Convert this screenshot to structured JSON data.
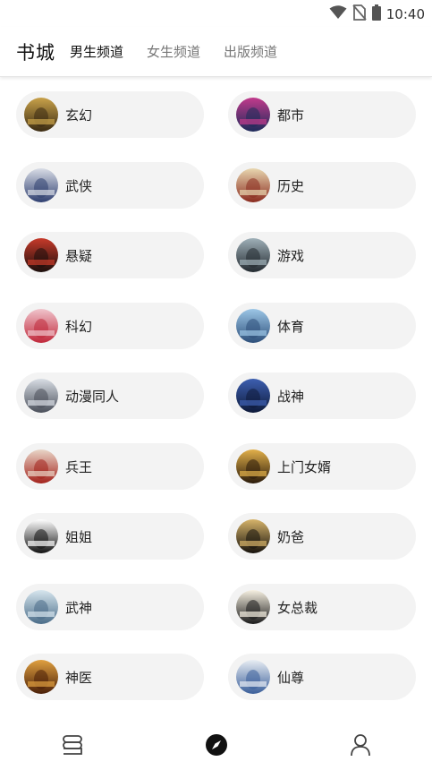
{
  "status_bar": {
    "time": "10:40",
    "icons": [
      "wifi-icon",
      "no-sim-icon",
      "battery-icon"
    ]
  },
  "header": {
    "brand": "书城",
    "tabs": [
      {
        "label": "男生频道",
        "active": true
      },
      {
        "label": "女生频道",
        "active": false
      },
      {
        "label": "出版频道",
        "active": false
      }
    ]
  },
  "categories": [
    {
      "label": "玄幻",
      "cover_colors": [
        "#c9a24a",
        "#3a2a12"
      ]
    },
    {
      "label": "都市",
      "cover_colors": [
        "#c23a8c",
        "#1d2b5a"
      ]
    },
    {
      "label": "武侠",
      "cover_colors": [
        "#d9dde6",
        "#2f3f70"
      ]
    },
    {
      "label": "历史",
      "cover_colors": [
        "#e8d7b0",
        "#8a2b1f"
      ]
    },
    {
      "label": "悬疑",
      "cover_colors": [
        "#c73a2a",
        "#1a0e0c"
      ]
    },
    {
      "label": "游戏",
      "cover_colors": [
        "#9fb0b8",
        "#232a30"
      ]
    },
    {
      "label": "科幻",
      "cover_colors": [
        "#f0c4cc",
        "#c0283a"
      ]
    },
    {
      "label": "体育",
      "cover_colors": [
        "#9cc6e6",
        "#2d4f7a"
      ]
    },
    {
      "label": "动漫同人",
      "cover_colors": [
        "#d8dde4",
        "#4a4f5a"
      ]
    },
    {
      "label": "战神",
      "cover_colors": [
        "#3d5fb0",
        "#0e1a3a"
      ]
    },
    {
      "label": "兵王",
      "cover_colors": [
        "#e9d6c8",
        "#a3221c"
      ]
    },
    {
      "label": "上门女婿",
      "cover_colors": [
        "#e2b04a",
        "#2a1a0a"
      ]
    },
    {
      "label": "姐姐",
      "cover_colors": [
        "#ffffff",
        "#111111"
      ]
    },
    {
      "label": "奶爸",
      "cover_colors": [
        "#d7b46a",
        "#16120c"
      ]
    },
    {
      "label": "武神",
      "cover_colors": [
        "#d7e6ee",
        "#4a6c88"
      ]
    },
    {
      "label": "女总裁",
      "cover_colors": [
        "#f7f1e2",
        "#1a1a1a"
      ]
    },
    {
      "label": "神医",
      "cover_colors": [
        "#e0a040",
        "#4a1f08"
      ]
    },
    {
      "label": "仙尊",
      "cover_colors": [
        "#e8edf3",
        "#3b5f9a"
      ]
    }
  ],
  "bottom_nav": [
    {
      "name": "bookshelf",
      "icon": "bookshelf-icon",
      "active": false
    },
    {
      "name": "discover",
      "icon": "compass-icon",
      "active": true
    },
    {
      "name": "profile",
      "icon": "user-icon",
      "active": false
    }
  ]
}
